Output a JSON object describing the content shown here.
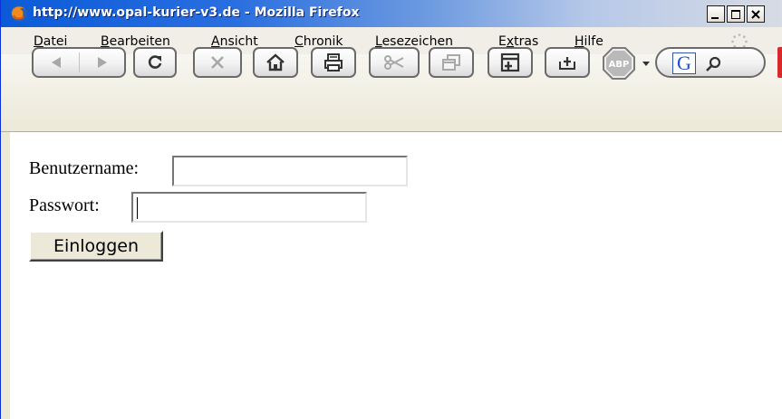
{
  "window": {
    "title": "http://www.opal-kurier-v3.de - Mozilla Firefox"
  },
  "menubar": {
    "items": [
      {
        "label": "Datei",
        "accel": "D",
        "rest": "atei"
      },
      {
        "label": "Bearbeiten",
        "accel": "B",
        "rest": "earbeiten"
      },
      {
        "label": "Ansicht",
        "accel": "A",
        "rest": "nsicht"
      },
      {
        "label": "Chronik",
        "accel": "C",
        "rest": "hronik"
      },
      {
        "label": "Lesezeichen",
        "accel": "L",
        "rest": "esezeichen"
      },
      {
        "label": "Extras",
        "pre": "E",
        "accel": "x",
        "rest": "tras"
      },
      {
        "label": "Hilfe",
        "accel": "H",
        "rest": "ilfe"
      }
    ]
  },
  "toolbar": {
    "buttons": [
      {
        "name": "back-icon"
      },
      {
        "name": "forward-icon"
      },
      {
        "name": "reload-icon"
      },
      {
        "name": "stop-icon"
      },
      {
        "name": "home-icon"
      },
      {
        "name": "print-icon"
      },
      {
        "name": "cut-icon"
      },
      {
        "name": "new-window-icon"
      },
      {
        "name": "new-tab-icon"
      },
      {
        "name": "download-icon"
      }
    ],
    "adblock_label": "ABP",
    "search_engine_letter": "G"
  },
  "form": {
    "username_label": "Benutzername:",
    "username_value": "",
    "password_label": "Passwort:",
    "password_value": "",
    "submit_label": "Einloggen"
  }
}
